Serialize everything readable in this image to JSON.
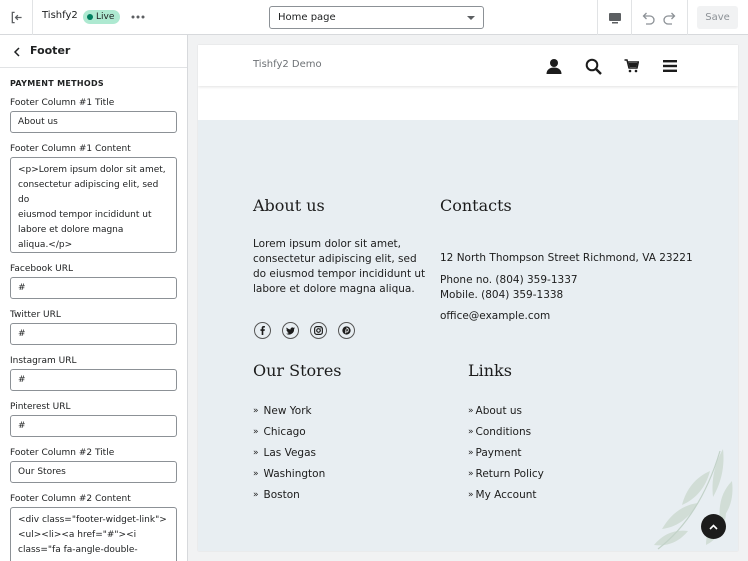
{
  "topbar": {
    "store_name": "Tishfy2",
    "status_badge": "Live",
    "page_select_value": "Home page",
    "save_label": "Save"
  },
  "sidebar": {
    "title": "Footer",
    "section_heading": "PAYMENT METHODS",
    "fields": {
      "col1_title_label": "Footer Column #1 Title",
      "col1_title_value": "About us",
      "col1_content_label": "Footer Column #1 Content",
      "col1_content_value": "<p>Lorem ipsum dolor sit amet,\nconsectetur adipiscing elit, sed do\neiusmod tempor incididunt ut\nlabore et dolore magna\naliqua.</p>",
      "facebook_label": "Facebook URL",
      "facebook_value": "#",
      "twitter_label": "Twitter URL",
      "twitter_value": "#",
      "instagram_label": "Instagram URL",
      "instagram_value": "#",
      "pinterest_label": "Pinterest URL",
      "pinterest_value": "#",
      "col2_title_label": "Footer Column #2 Title",
      "col2_title_value": "Our Stores",
      "col2_content_label": "Footer Column #2 Content",
      "col2_content_value": "<div class=\"footer-widget-link\">\n<ul><li><a href=\"#\"><i\nclass=\"fa fa-angle-double-"
    }
  },
  "preview": {
    "site_logo": "Tishfy2 Demo",
    "footer": {
      "about_title": "About us",
      "about_text": "Lorem ipsum dolor sit amet, consectetur adipiscing elit, sed do eiusmod tempor incididunt ut labore et dolore magna aliqua.",
      "contacts_title": "Contacts",
      "address": "12 North Thompson Street Richmond, VA 23221",
      "phone": "Phone no. (804) 359-1337",
      "mobile": "Mobile. (804) 359-1338",
      "email": "office@example.com",
      "stores_title": "Our Stores",
      "stores": [
        "New York",
        "Chicago",
        "Las Vegas",
        "Washington",
        "Boston"
      ],
      "links_title": "Links",
      "links": [
        "About us",
        "Conditions",
        "Payment",
        "Return Policy",
        "My Account"
      ]
    }
  }
}
